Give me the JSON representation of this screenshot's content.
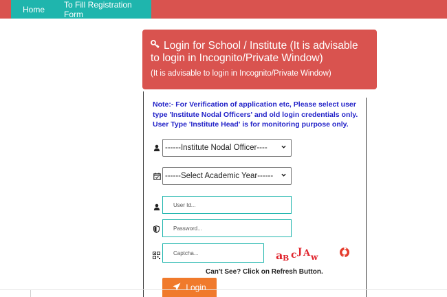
{
  "nav": {
    "home_label": "Home",
    "register_label": "To Fill Registration Form"
  },
  "login_panel": {
    "title": "Login for School / Institute (It is advisable to login in Incognito/Private Window)",
    "subtitle": "(It is advisable to login in Incognito/Private Window)",
    "note": "Note:- For Verification of application etc, Please select user type 'Institute Nodal Officers' and old login credentials only. User Type 'Institute Head' is for monitoring purpose only."
  },
  "form": {
    "user_type_selected": "------Institute Nodal Officer----",
    "academic_year_selected": "------Select Academic Year------",
    "user_id_placeholder": "User Id...",
    "password_placeholder": "Password...",
    "captcha_placeholder": "Captcha...",
    "captcha_text": "aB cJAw",
    "cant_see_text": "Can't See? Click on Refresh Button.",
    "login_label": "Login"
  },
  "colors": {
    "brand_red": "#d9534f",
    "teal": "#1fb5ad",
    "note_blue": "#2323c8",
    "login_orange": "#f07a2c",
    "captcha_red": "#e0252e"
  },
  "icons": [
    "key-icon",
    "user-icon",
    "calendar-icon",
    "user-icon",
    "shield-icon",
    "captcha-icon",
    "refresh-icon",
    "paper-plane-icon"
  ]
}
